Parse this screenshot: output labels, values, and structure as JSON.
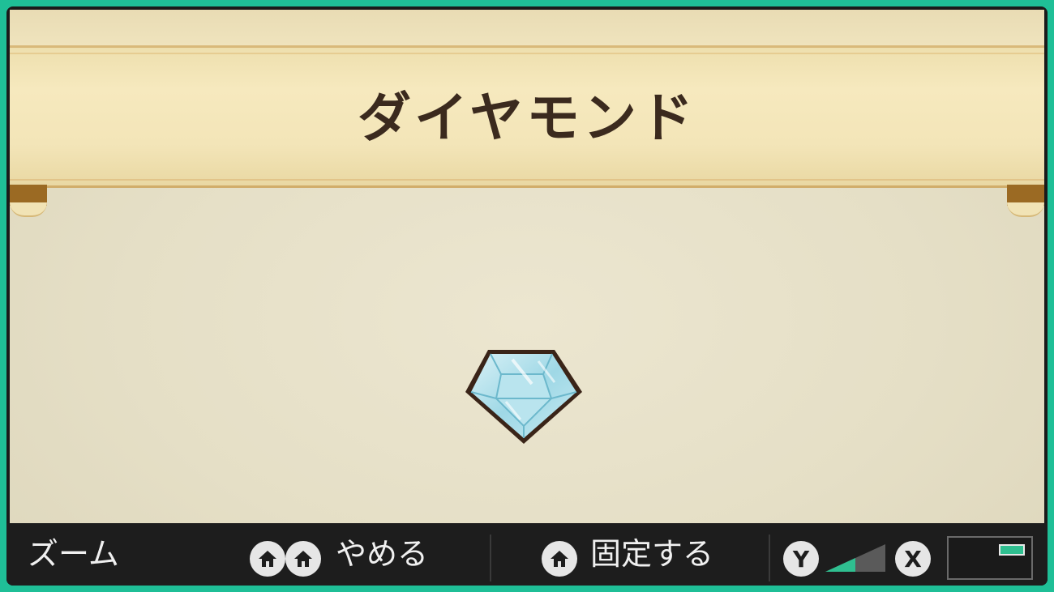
{
  "item": {
    "name": "ダイヤモンド",
    "icon": "diamond-gem-icon"
  },
  "controls": {
    "zoom_label": "ズーム",
    "quit_label": "やめる",
    "quit_icons": [
      "home-button-icon",
      "home-button-icon"
    ],
    "pin_label": "固定する",
    "pin_icon": "home-button-icon",
    "zoom_out_button": "Y",
    "zoom_in_button": "X",
    "zoom_level": 0.5
  },
  "colors": {
    "frame": "#1fbf97",
    "ribbon": "#f3e5b8",
    "title_text": "#3b2a1e",
    "zoom_fill": "#2fbf90"
  }
}
